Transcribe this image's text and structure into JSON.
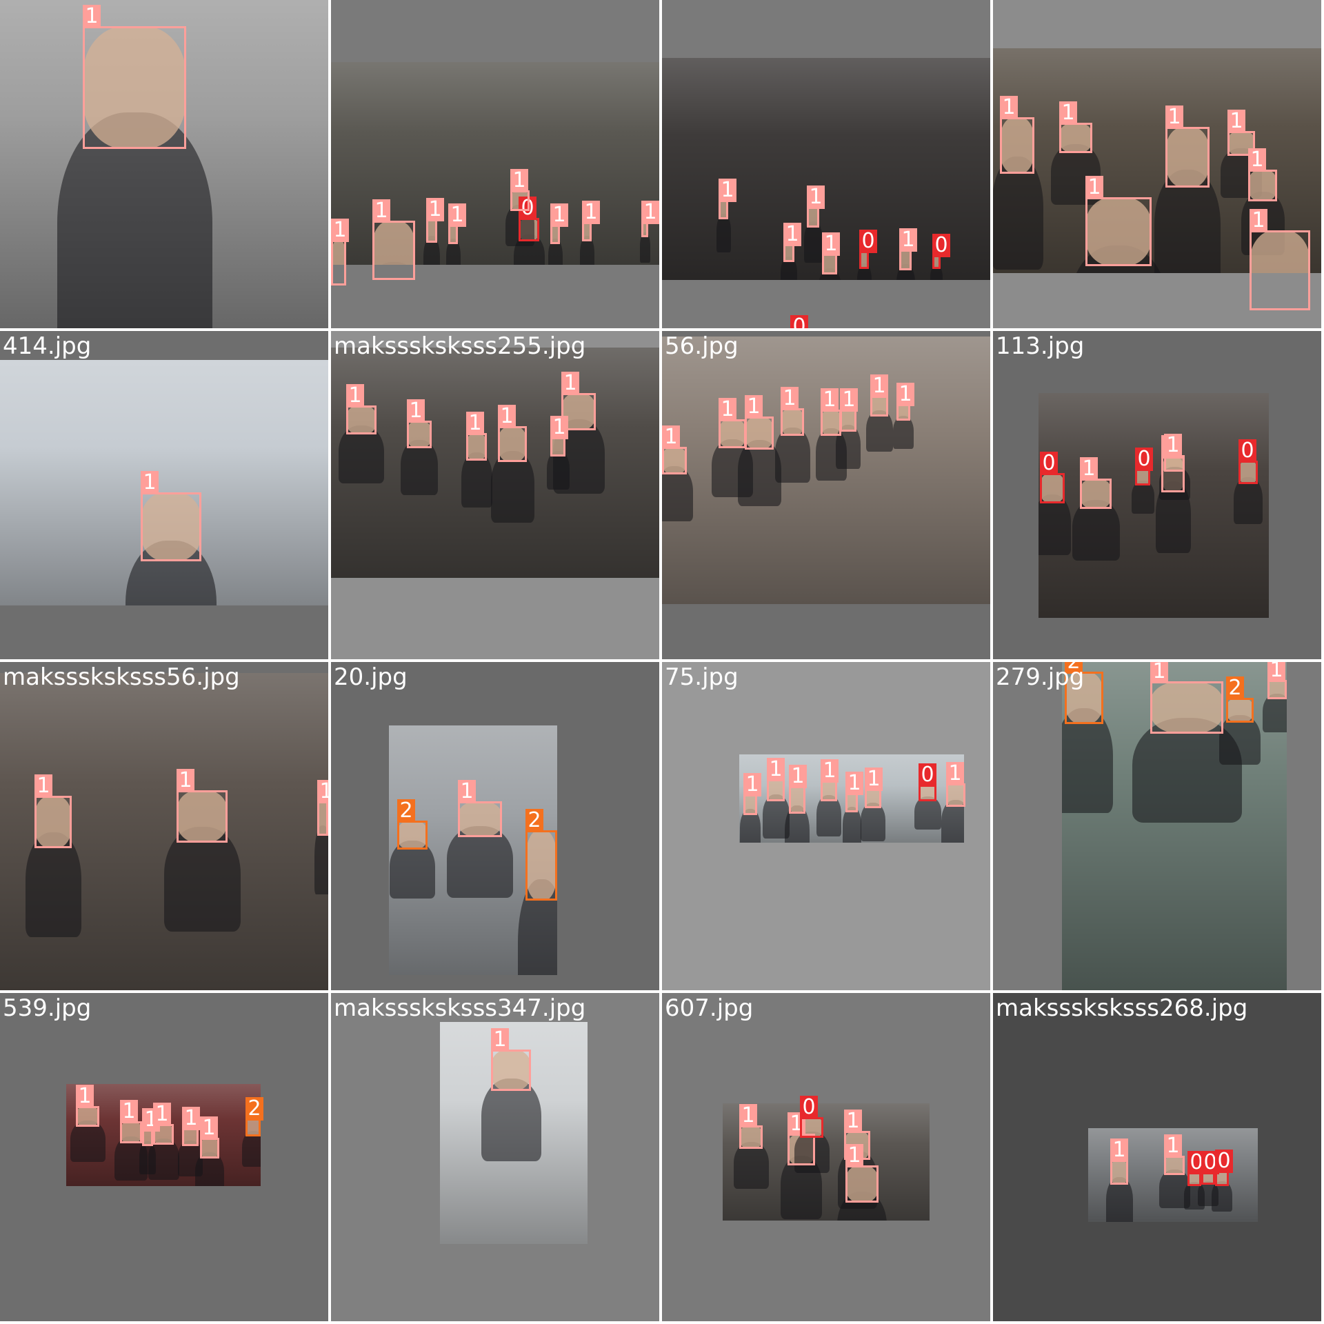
{
  "grid": {
    "tiles": [
      {
        "label": "",
        "bg": "#7a7a7a",
        "photo": {
          "bg": "#9e9e9e",
          "tone": "portrait-grey"
        },
        "boxes": [
          {
            "cls": "1"
          }
        ]
      },
      {
        "label": "",
        "bg": "#7a7a7a",
        "photo": {
          "bg": "#5a5852",
          "tone": "street"
        },
        "boxes": [
          {
            "cls": "1"
          },
          {
            "cls": "1"
          },
          {
            "cls": "1"
          },
          {
            "cls": "1"
          },
          {
            "cls": "0"
          },
          {
            "cls": "1"
          },
          {
            "cls": "1"
          },
          {
            "cls": "1"
          },
          {
            "cls": "1"
          }
        ]
      },
      {
        "label": "",
        "bg": "#7a7a7a",
        "photo": {
          "bg": "#3e3b3a",
          "tone": "crowd"
        },
        "boxes": [
          {
            "cls": "1"
          },
          {
            "cls": "1"
          },
          {
            "cls": "1"
          },
          {
            "cls": "1"
          },
          {
            "cls": "0"
          },
          {
            "cls": "1"
          },
          {
            "cls": "0"
          },
          {
            "cls": "0"
          }
        ]
      },
      {
        "label": "",
        "bg": "#8c8c8c",
        "photo": {
          "bg": "#5a5248",
          "tone": "crowd-close"
        },
        "boxes": [
          {
            "cls": "1"
          },
          {
            "cls": "1"
          },
          {
            "cls": "1"
          },
          {
            "cls": "1"
          },
          {
            "cls": "1"
          },
          {
            "cls": "1"
          },
          {
            "cls": "1"
          }
        ]
      },
      {
        "label": "414.jpg",
        "bg": "#6e6e6e",
        "photo": {
          "bg": "#c6ccd2",
          "tone": "wall"
        },
        "boxes": [
          {
            "cls": "1"
          }
        ]
      },
      {
        "label": "maksssksksss255.jpg",
        "bg": "#909090",
        "photo": {
          "bg": "#504c48",
          "tone": "protest"
        },
        "boxes": [
          {
            "cls": "1"
          },
          {
            "cls": "1"
          },
          {
            "cls": "1"
          },
          {
            "cls": "1"
          },
          {
            "cls": "1"
          },
          {
            "cls": "1"
          }
        ]
      },
      {
        "label": "56.jpg",
        "bg": "#6e6e6e",
        "photo": {
          "bg": "#8a7f76",
          "tone": "market"
        },
        "boxes": [
          {
            "cls": "1"
          },
          {
            "cls": "1"
          },
          {
            "cls": "1"
          },
          {
            "cls": "1"
          },
          {
            "cls": "1"
          },
          {
            "cls": "1"
          },
          {
            "cls": "1"
          },
          {
            "cls": "1"
          }
        ]
      },
      {
        "label": "113.jpg",
        "bg": "#6a6a6a",
        "photo": {
          "bg": "#4a4440",
          "tone": "press"
        },
        "boxes": [
          {
            "cls": "0"
          },
          {
            "cls": "1"
          },
          {
            "cls": "0"
          },
          {
            "cls": "1"
          },
          {
            "cls": "1"
          },
          {
            "cls": "0"
          }
        ]
      },
      {
        "label": "maksssksksss56.jpg",
        "bg": "#6e6e6e",
        "photo": {
          "bg": "#5e5650",
          "tone": "winter"
        },
        "boxes": [
          {
            "cls": "1"
          },
          {
            "cls": "1"
          },
          {
            "cls": "1"
          }
        ]
      },
      {
        "label": "20.jpg",
        "bg": "#6a6a6a",
        "photo": {
          "bg": "#9ea2a6",
          "tone": "airport"
        },
        "boxes": [
          {
            "cls": "1"
          },
          {
            "cls": "2"
          },
          {
            "cls": "2"
          }
        ]
      },
      {
        "label": "75.jpg",
        "bg": "#999999",
        "photo": {
          "bg": "#b9c0c4",
          "tone": "station"
        },
        "boxes": [
          {
            "cls": "1"
          },
          {
            "cls": "1"
          },
          {
            "cls": "1"
          },
          {
            "cls": "1"
          },
          {
            "cls": "1"
          },
          {
            "cls": "1"
          },
          {
            "cls": "0"
          },
          {
            "cls": "1"
          }
        ]
      },
      {
        "label": "279.jpg",
        "bg": "#7a7a7a",
        "photo": {
          "bg": "#6f7f78",
          "tone": "green"
        },
        "boxes": [
          {
            "cls": "2"
          },
          {
            "cls": "1"
          },
          {
            "cls": "2"
          },
          {
            "cls": "1"
          }
        ]
      },
      {
        "label": "539.jpg",
        "bg": "#6e6e6e",
        "photo": {
          "bg": "#6c3434",
          "tone": "red"
        },
        "boxes": [
          {
            "cls": "1"
          },
          {
            "cls": "1"
          },
          {
            "cls": "1"
          },
          {
            "cls": "1"
          },
          {
            "cls": "1"
          },
          {
            "cls": "1"
          },
          {
            "cls": "2"
          }
        ]
      },
      {
        "label": "maksssksksss347.jpg",
        "bg": "#808080",
        "photo": {
          "bg": "#cfd2d4",
          "tone": "white-hall"
        },
        "boxes": [
          {
            "cls": "1"
          }
        ]
      },
      {
        "label": "607.jpg",
        "bg": "#7a7a7a",
        "photo": {
          "bg": "#5a5652",
          "tone": "street2"
        },
        "boxes": [
          {
            "cls": "1"
          },
          {
            "cls": "1"
          },
          {
            "cls": "0"
          },
          {
            "cls": "1"
          },
          {
            "cls": "1"
          }
        ]
      },
      {
        "label": "maksssksksss268.jpg",
        "bg": "#4a4a4a",
        "photo": {
          "bg": "#7c7f82",
          "tone": "building"
        },
        "boxes": [
          {
            "cls": "1"
          },
          {
            "cls": "1"
          },
          {
            "cls": "0"
          },
          {
            "cls": "0"
          },
          {
            "cls": "0"
          }
        ]
      }
    ]
  },
  "class_colors": {
    "0": "#e8292c",
    "1": "#ff9f9a",
    "2": "#f4701e"
  }
}
